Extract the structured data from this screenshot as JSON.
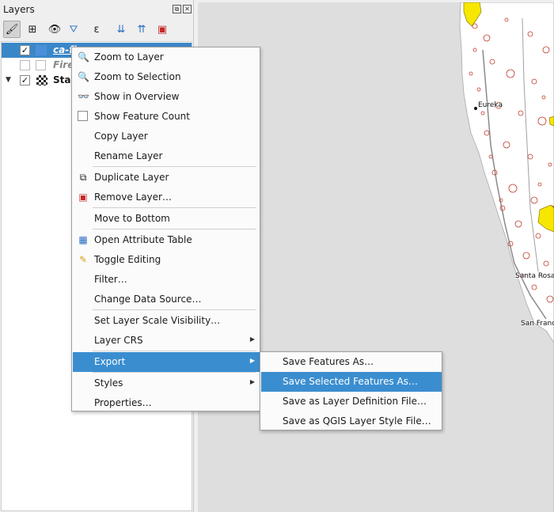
{
  "panel": {
    "title": "Layers",
    "float_glyph": "⧉",
    "close_glyph": "✕"
  },
  "toolbar": {
    "buttons": [
      {
        "name": "style-manager-icon",
        "glyph": "🖌",
        "active": true
      },
      {
        "name": "add-group-icon",
        "glyph": "⊞"
      },
      {
        "name": "manage-visibility-icon",
        "glyph": "👁"
      },
      {
        "name": "filter-legend-icon",
        "glyph": "⛛"
      },
      {
        "name": "filter-expression-icon",
        "glyph": "ε"
      },
      {
        "name": "expand-all-icon",
        "glyph": "⇊"
      },
      {
        "name": "collapse-all-icon",
        "glyph": "⇈"
      },
      {
        "name": "remove-layer-icon",
        "glyph": "▣"
      }
    ]
  },
  "tree": {
    "rows": [
      {
        "name": "ca-fi",
        "checked": true,
        "selected": true
      },
      {
        "name": "Fire",
        "checked": false,
        "disabled": true
      },
      {
        "name": "Stan",
        "checked": true,
        "expanded": true
      }
    ],
    "check_glyph": "✓",
    "expander_glyph": "▼"
  },
  "map": {
    "colors": {
      "background": "#dedede",
      "land": "#ffffff",
      "fire_perimeters": "#c0392b",
      "highlight": "#f7e600",
      "roads": "#8a8a8a"
    },
    "cities": [
      "Eureka",
      "Santa Rosa",
      "San Franc"
    ]
  },
  "context_menu": {
    "items": [
      {
        "label": "Zoom to Layer",
        "icon": "zoom-layer-icon",
        "glyph": "🔍"
      },
      {
        "label": "Zoom to Selection",
        "icon": "zoom-selection-icon",
        "glyph": "🔍"
      },
      {
        "label": "Show in Overview",
        "icon": "overview-icon",
        "glyph": "👓"
      },
      {
        "label": "Show Feature Count",
        "icon": "checkbox",
        "glyph": ""
      },
      {
        "label": "Copy Layer"
      },
      {
        "label": "Rename Layer"
      },
      {
        "label": "Duplicate Layer",
        "icon": "duplicate-layer-icon",
        "glyph": "⧉"
      },
      {
        "label": "Remove Layer…",
        "icon": "remove-layer-icon",
        "glyph": "▣"
      },
      {
        "label": "Move to Bottom"
      },
      {
        "label": "Open Attribute Table",
        "icon": "attribute-table-icon",
        "glyph": "▦"
      },
      {
        "label": "Toggle Editing",
        "icon": "pencil-icon",
        "glyph": "✎"
      },
      {
        "label": "Filter…"
      },
      {
        "label": "Change Data Source…"
      },
      {
        "label": "Set Layer Scale Visibility…"
      },
      {
        "label": "Layer CRS",
        "submenu": true
      },
      {
        "label": "Export",
        "submenu": true,
        "highlighted": true
      },
      {
        "label": "Styles",
        "submenu": true
      },
      {
        "label": "Properties…"
      }
    ],
    "arrow_glyph": "▶"
  },
  "export_submenu": {
    "items": [
      {
        "label": "Save Features As…"
      },
      {
        "label": "Save Selected Features As…",
        "highlighted": true
      },
      {
        "label": "Save as Layer Definition File…"
      },
      {
        "label": "Save as QGIS Layer Style File…"
      }
    ]
  }
}
